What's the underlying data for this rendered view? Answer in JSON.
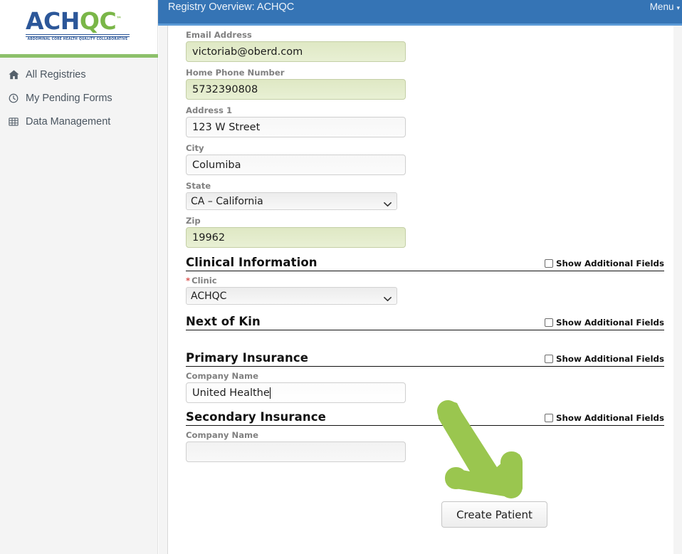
{
  "brand": {
    "logo_text_primary": "ACH",
    "logo_text_secondary": "QC",
    "logo_tm": "™",
    "logo_tagline": "ABDOMINAL CORE HEALTH QUALITY COLLABORATIVE",
    "blue": "#2c5799",
    "green": "#7ab648",
    "divider_green": "#8dc06b"
  },
  "topbar": {
    "title": "Registry Overview: ACHQC",
    "menu_label": "Menu",
    "menu_caret": "▾",
    "background": "#3574b5"
  },
  "sidebar": {
    "items": [
      {
        "label": "All Registries",
        "icon": "home-icon"
      },
      {
        "label": "My Pending Forms",
        "icon": "clock-icon"
      },
      {
        "label": "Data Management",
        "icon": "table-icon"
      }
    ]
  },
  "form": {
    "fields": [
      {
        "label": "Email Address",
        "value": "victoriab@oberd.com",
        "state": "filled"
      },
      {
        "label": "Home Phone Number",
        "value": "5732390808",
        "state": "filled"
      },
      {
        "label": "Address 1",
        "value": "123 W Street",
        "state": "normal"
      },
      {
        "label": "City",
        "value": "Columiba",
        "state": "normal"
      }
    ],
    "state_field": {
      "label": "State",
      "value": "CA – California",
      "options": [
        "CA – California"
      ]
    },
    "zip_field": {
      "label": "Zip",
      "value": "19962",
      "state": "filled"
    },
    "clinic_field": {
      "label": "Clinic",
      "required_marker": "*",
      "value": "ACHQC",
      "options": [
        "ACHQC"
      ]
    },
    "primary_insurance_company": {
      "label": "Company Name",
      "value": "United Healthe",
      "state": "active"
    },
    "secondary_insurance_company": {
      "label": "Company Name",
      "value": "",
      "state": "empty"
    }
  },
  "sections": [
    {
      "title": "Clinical Information",
      "toggle_label": "Show Additional Fields",
      "checked": false
    },
    {
      "title": "Next of Kin",
      "toggle_label": "Show Additional Fields",
      "checked": false
    },
    {
      "title": "Primary Insurance",
      "toggle_label": "Show Additional Fields",
      "checked": false
    },
    {
      "title": "Secondary Insurance",
      "toggle_label": "Show Additional Fields",
      "checked": false
    }
  ],
  "actions": {
    "create_patient_label": "Create Patient"
  },
  "annotation": {
    "arrow_color": "#9ac64f",
    "arrow_direction": "down-right",
    "points_at": "Create Patient"
  }
}
